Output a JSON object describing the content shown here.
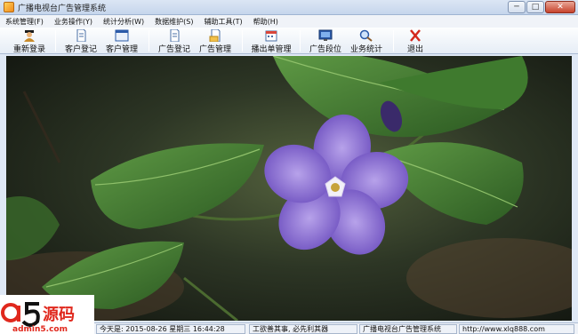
{
  "window": {
    "title": "广播电视台广告管理系统",
    "min": "─",
    "max": "□",
    "close": "✕"
  },
  "menu": [
    "系统管理(F)",
    "业务操作(Y)",
    "统计分析(W)",
    "数据维护(S)",
    "辅助工具(T)",
    "帮助(H)"
  ],
  "toolbar": [
    {
      "label": "重新登录",
      "icon": "user-icon"
    },
    {
      "label": "客户登记",
      "icon": "document-icon"
    },
    {
      "label": "客户管理",
      "icon": "window-icon"
    },
    {
      "label": "广告登记",
      "icon": "document-icon"
    },
    {
      "label": "广告管理",
      "icon": "document-folder-icon"
    },
    {
      "label": "播出单管理",
      "icon": "calendar-icon"
    },
    {
      "label": "广告段位",
      "icon": "monitor-icon"
    },
    {
      "label": "业务统计",
      "icon": "magnifier-icon"
    },
    {
      "label": "退出",
      "icon": "close-icon"
    }
  ],
  "status": {
    "datetime": "今天是: 2015-08-26 星期三 16:44:28",
    "motto": "工欲善其事, 必先利其器",
    "system": "广播电视台广告管理系统",
    "url": "http://www.xlq888.com"
  },
  "watermark": {
    "brand": "a5源码",
    "url": "admin5.com"
  },
  "colors": {
    "titlebar": "#c6d6ec",
    "accent": "#2b5aa8",
    "petal": "#8a6bd1",
    "leaf": "#3f7a2e",
    "logo_red": "#e0281d"
  }
}
